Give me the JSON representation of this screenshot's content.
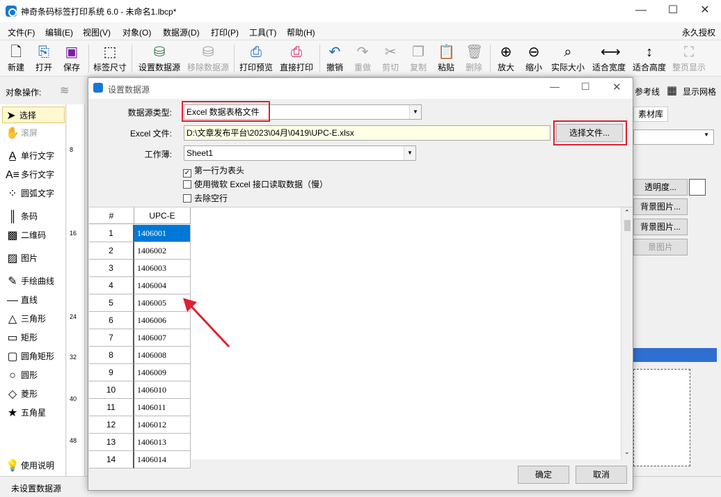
{
  "window": {
    "title": "神奇条码标签打印系统 6.0 - 未命名1.lbcp*"
  },
  "menu": {
    "items": [
      "文件(F)",
      "编辑(E)",
      "视图(V)",
      "对象(O)",
      "数据源(D)",
      "打印(P)",
      "工具(T)",
      "帮助(H)"
    ],
    "right": "永久授权"
  },
  "toolbar": {
    "buttons": [
      "新建",
      "打开",
      "保存",
      "标签尺寸",
      "设置数据源",
      "移除数据源",
      "打印预览",
      "直接打印",
      "撤销",
      "重做",
      "剪切",
      "复制",
      "粘贴",
      "删除",
      "放大",
      "缩小",
      "实际大小",
      "适合宽度",
      "适合高度",
      "整页显示"
    ]
  },
  "objbar": {
    "label": "对象操作:",
    "guides": "参考线",
    "grid": "显示网格"
  },
  "left": {
    "items": [
      "选择",
      "滚屏",
      "单行文字",
      "多行文字",
      "圆弧文字",
      "条码",
      "二维码",
      "图片",
      "手绘曲线",
      "直线",
      "三角形",
      "矩形",
      "圆角矩形",
      "圆形",
      "菱形",
      "五角星"
    ],
    "help": "使用说明"
  },
  "ruler": {
    "marks": [
      "8",
      "16",
      "24",
      "32",
      "40",
      "48"
    ]
  },
  "right": {
    "tab": "素材库",
    "buttons": [
      "透明度...",
      "背景图片...",
      "背景图片...",
      "景图片"
    ]
  },
  "status": {
    "text": "未设置数据源"
  },
  "dialog": {
    "title": "设置数据源",
    "type_label": "数据源类型:",
    "type_value": "Excel 数据表格文件",
    "file_label": "Excel 文件:",
    "file_value": "D:\\文章发布平台\\2023\\04月\\0419\\UPC-E.xlsx",
    "choose_label": "选择文件...",
    "sheet_label": "工作薄:",
    "sheet_value": "Sheet1",
    "opt_header": "第一行为表头",
    "opt_ms": "使用微软 Excel 接口读取数据（慢）",
    "opt_empty": "去除空行",
    "grid": {
      "col_num": "#",
      "col_name": "UPC-E",
      "rows": [
        [
          "1",
          "1406001"
        ],
        [
          "2",
          "1406002"
        ],
        [
          "3",
          "1406003"
        ],
        [
          "4",
          "1406004"
        ],
        [
          "5",
          "1406005"
        ],
        [
          "6",
          "1406006"
        ],
        [
          "7",
          "1406007"
        ],
        [
          "8",
          "1406008"
        ],
        [
          "9",
          "1406009"
        ],
        [
          "10",
          "1406010"
        ],
        [
          "11",
          "1406011"
        ],
        [
          "12",
          "1406012"
        ],
        [
          "13",
          "1406013"
        ],
        [
          "14",
          "1406014"
        ]
      ]
    },
    "ok": "确定",
    "cancel": "取消"
  }
}
